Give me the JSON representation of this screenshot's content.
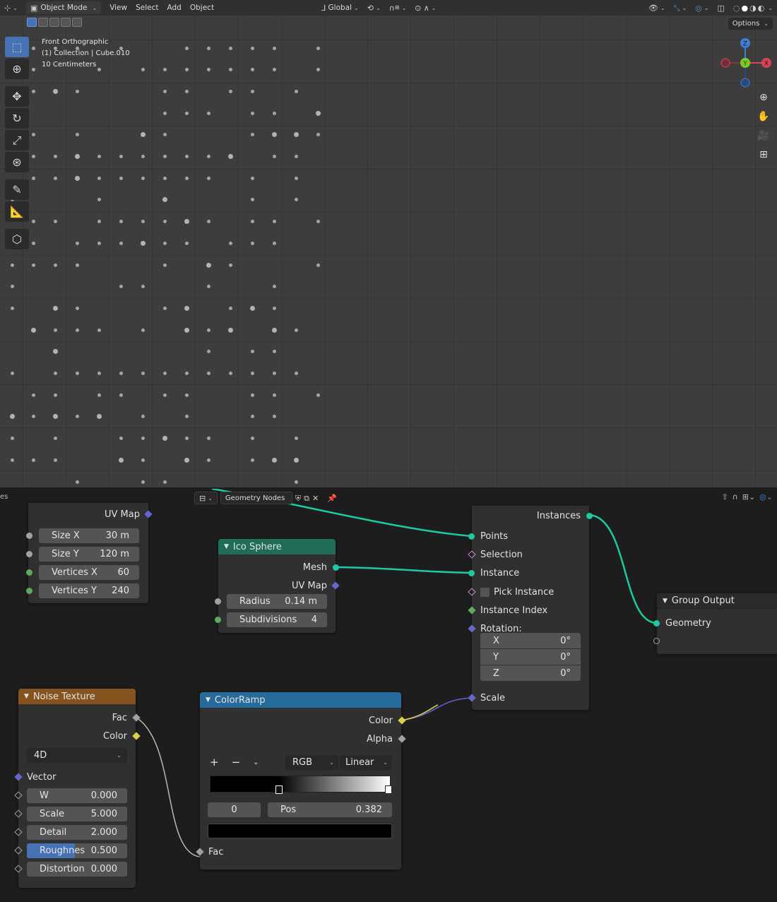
{
  "viewport": {
    "header": {
      "mode_label": "Object Mode",
      "menu": [
        "View",
        "Select",
        "Add",
        "Object"
      ],
      "transform_orientation": "Global",
      "options_label": "Options"
    },
    "info": {
      "view_name": "Front Orthographic",
      "collection": "(1) Collection | Cube.010",
      "scale": "10 Centimeters"
    },
    "gizmo": {
      "x_label": "X",
      "y_label": "Y",
      "z_label": "Z",
      "x_color": "#d6435a",
      "y_color": "#7dc922",
      "z_color": "#3f7ed6"
    },
    "tools": [
      "select-box-icon",
      "cursor-icon",
      "move-icon",
      "rotate-icon",
      "scale-icon",
      "transform-icon",
      "annotate-icon",
      "measure-icon",
      "add-cube-icon"
    ]
  },
  "node_editor": {
    "tree_name": "Geometry Nodes",
    "grid_node": {
      "output_uvmap": "UV Map",
      "fields": [
        {
          "label": "Size X",
          "value": "30 m"
        },
        {
          "label": "Size Y",
          "value": "120 m"
        },
        {
          "label": "Vertices X",
          "value": "60"
        },
        {
          "label": "Vertices Y",
          "value": "240"
        }
      ]
    },
    "ico_sphere": {
      "title": "Ico Sphere",
      "out_mesh": "Mesh",
      "out_uvmap": "UV Map",
      "radius_label": "Radius",
      "radius_value": "0.14 m",
      "subdiv_label": "Subdivisions",
      "subdiv_value": "4",
      "header_color": "#1f6d57"
    },
    "instance_node": {
      "out_instances": "Instances",
      "points": "Points",
      "selection": "Selection",
      "instance": "Instance",
      "pick_instance": "Pick Instance",
      "instance_index": "Instance Index",
      "rotation": "Rotation:",
      "rot": [
        {
          "axis": "X",
          "value": "0°"
        },
        {
          "axis": "Y",
          "value": "0°"
        },
        {
          "axis": "Z",
          "value": "0°"
        }
      ],
      "scale": "Scale"
    },
    "group_output": {
      "title": "Group Output",
      "geometry": "Geometry"
    },
    "noise_texture": {
      "title": "Noise Texture",
      "out_fac": "Fac",
      "out_color": "Color",
      "dimension": "4D",
      "vector": "Vector",
      "fields": [
        {
          "label": "W",
          "value": "0.000"
        },
        {
          "label": "Scale",
          "value": "5.000"
        },
        {
          "label": "Detail",
          "value": "2.000"
        },
        {
          "label": "Roughnes",
          "value": "0.500"
        },
        {
          "label": "Distortion",
          "value": "0.000"
        }
      ],
      "header_color": "#86531f"
    },
    "color_ramp": {
      "title": "ColorRamp",
      "out_color": "Color",
      "out_alpha": "Alpha",
      "add": "+",
      "remove": "−",
      "color_mode": "RGB",
      "interpolation": "Linear",
      "index": "0",
      "pos_label": "Pos",
      "pos_value": "0.382",
      "in_fac": "Fac",
      "header_color": "#276b9a"
    }
  }
}
